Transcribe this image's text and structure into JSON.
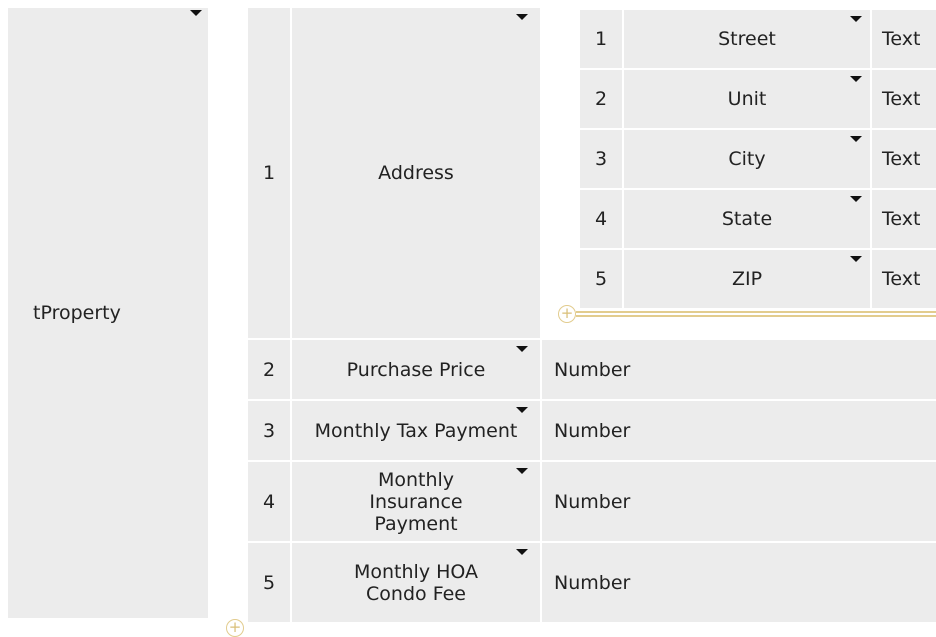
{
  "table_name": "tProperty",
  "fields": [
    {
      "index": "1",
      "name": "Address"
    },
    {
      "index": "2",
      "name": "Purchase Price",
      "type": "Number"
    },
    {
      "index": "3",
      "name": "Monthly Tax Payment",
      "type": "Number"
    },
    {
      "index": "4",
      "name": "Monthly Insurance Payment",
      "type": "Number"
    },
    {
      "index": "5",
      "name": "Monthly HOA Condo Fee",
      "type": "Number"
    }
  ],
  "address_fields": [
    {
      "index": "1",
      "name": "Street",
      "type": "Text"
    },
    {
      "index": "2",
      "name": "Unit",
      "type": "Text"
    },
    {
      "index": "3",
      "name": "City",
      "type": "Text"
    },
    {
      "index": "4",
      "name": "State",
      "type": "Text"
    },
    {
      "index": "5",
      "name": "ZIP",
      "type": "Text"
    }
  ],
  "icons": {
    "add": "plus-circle-icon",
    "menu": "caret-down-icon"
  }
}
